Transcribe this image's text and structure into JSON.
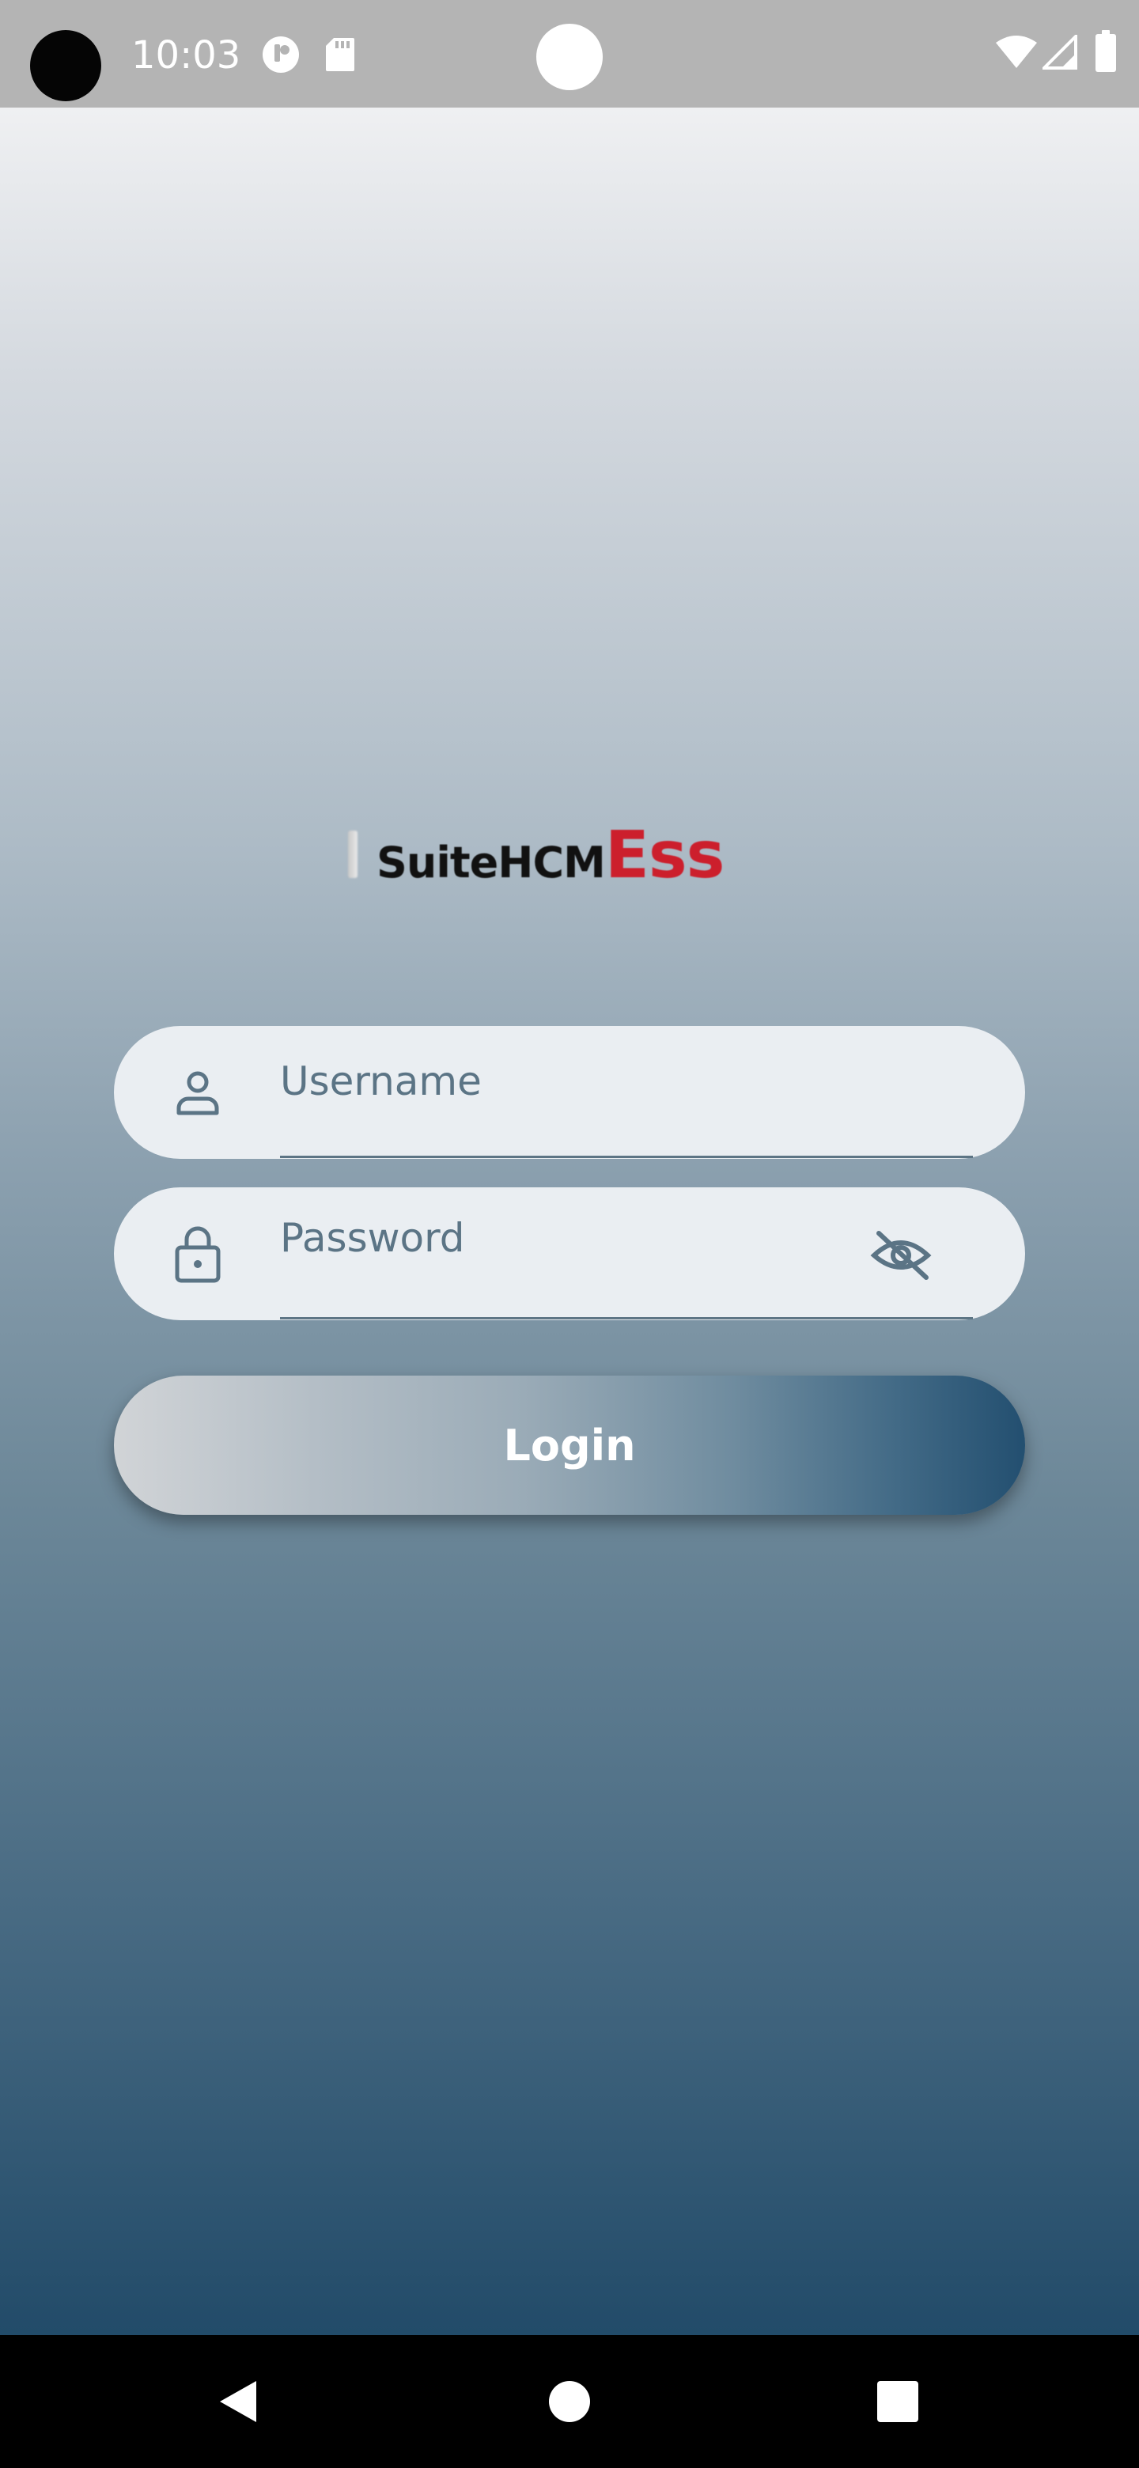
{
  "status_bar": {
    "time": "10:03",
    "icons": [
      "notification-app-icon",
      "sd-card-icon",
      "wifi-icon",
      "signal-icon",
      "battery-icon"
    ]
  },
  "app": {
    "logo": {
      "text_primary": "SuiteHCM",
      "text_accent": "Ess",
      "accent_color": "#cc1f2c"
    },
    "username_field": {
      "placeholder": "Username",
      "value": "",
      "icon": "person-icon"
    },
    "password_field": {
      "placeholder": "Password",
      "value": "",
      "icon": "lock-icon",
      "visibility_icon": "eye-off-icon"
    },
    "login_button": {
      "label": "Login"
    },
    "colors": {
      "gradient_top": "#eff0f2",
      "gradient_bottom": "#224b69",
      "field_background": "#eaeef2",
      "field_text": "#5a7384"
    }
  },
  "nav_bar": {
    "buttons": [
      "back-icon",
      "home-icon",
      "recents-icon"
    ]
  }
}
